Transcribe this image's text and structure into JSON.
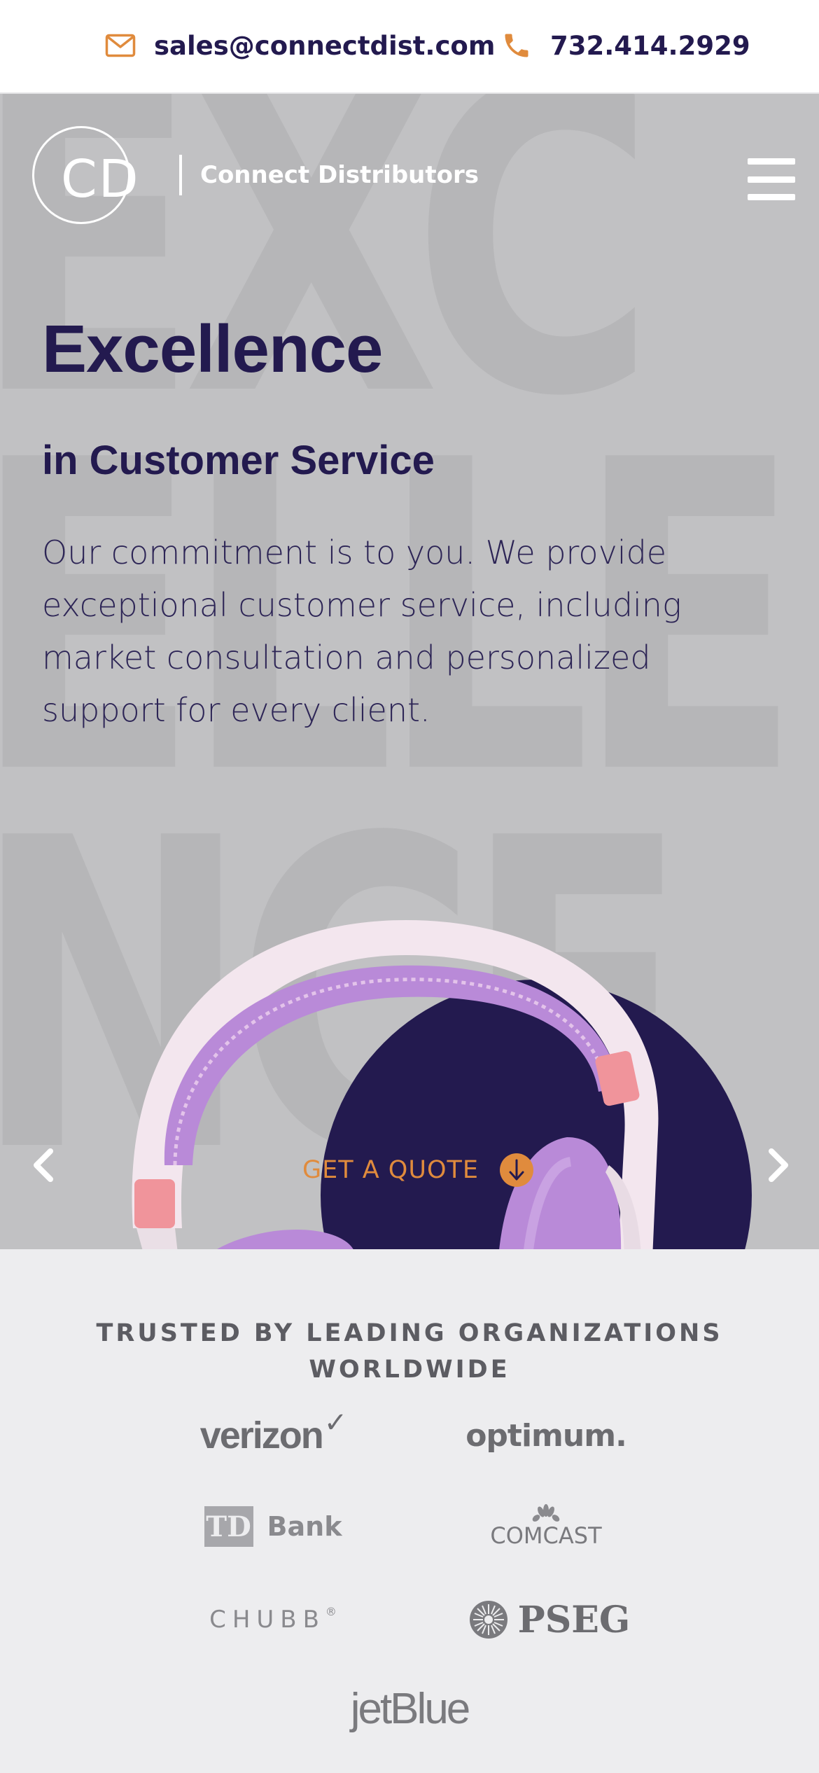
{
  "topbar": {
    "email": "sales@connectdist.com",
    "phone": "732.414.2929",
    "email_icon": "envelope-icon",
    "phone_icon": "phone-icon"
  },
  "header": {
    "logo_initials": "CD",
    "company_name": "Connect Distributors",
    "menu_icon": "hamburger-menu-icon"
  },
  "hero": {
    "background_word": "EXC\nELLE\nNCE",
    "title": "Excellence",
    "subtitle": "in Customer Service",
    "description": "Our commitment is to you. We provide exceptional customer service, including market consultation and personalized support for every client.",
    "cta_label": "GET A QUOTE",
    "cta_icon": "arrow-down-circle-icon",
    "prev_icon": "chevron-left-icon",
    "next_icon": "chevron-right-icon",
    "image": "purple-headphones"
  },
  "trusted": {
    "title": "TRUSTED BY LEADING ORGANIZATIONS WORLDWIDE",
    "logos": {
      "verizon": "verizon",
      "verizon_mark": "✓",
      "optimum": "optimum.",
      "td_mark": "TD",
      "td_bank": "Bank",
      "comcast": "COMCAST",
      "chubb": "CHUBB",
      "chubb_mark": "®",
      "pseg": "PSEG",
      "jetblue": "jetBlue"
    }
  },
  "colors": {
    "navy": "#231a4f",
    "accent_orange": "#e08b3d",
    "hero_bg": "#c1c1c3",
    "section_bg": "#ededef",
    "logo_gray": "#7a7a7e"
  }
}
